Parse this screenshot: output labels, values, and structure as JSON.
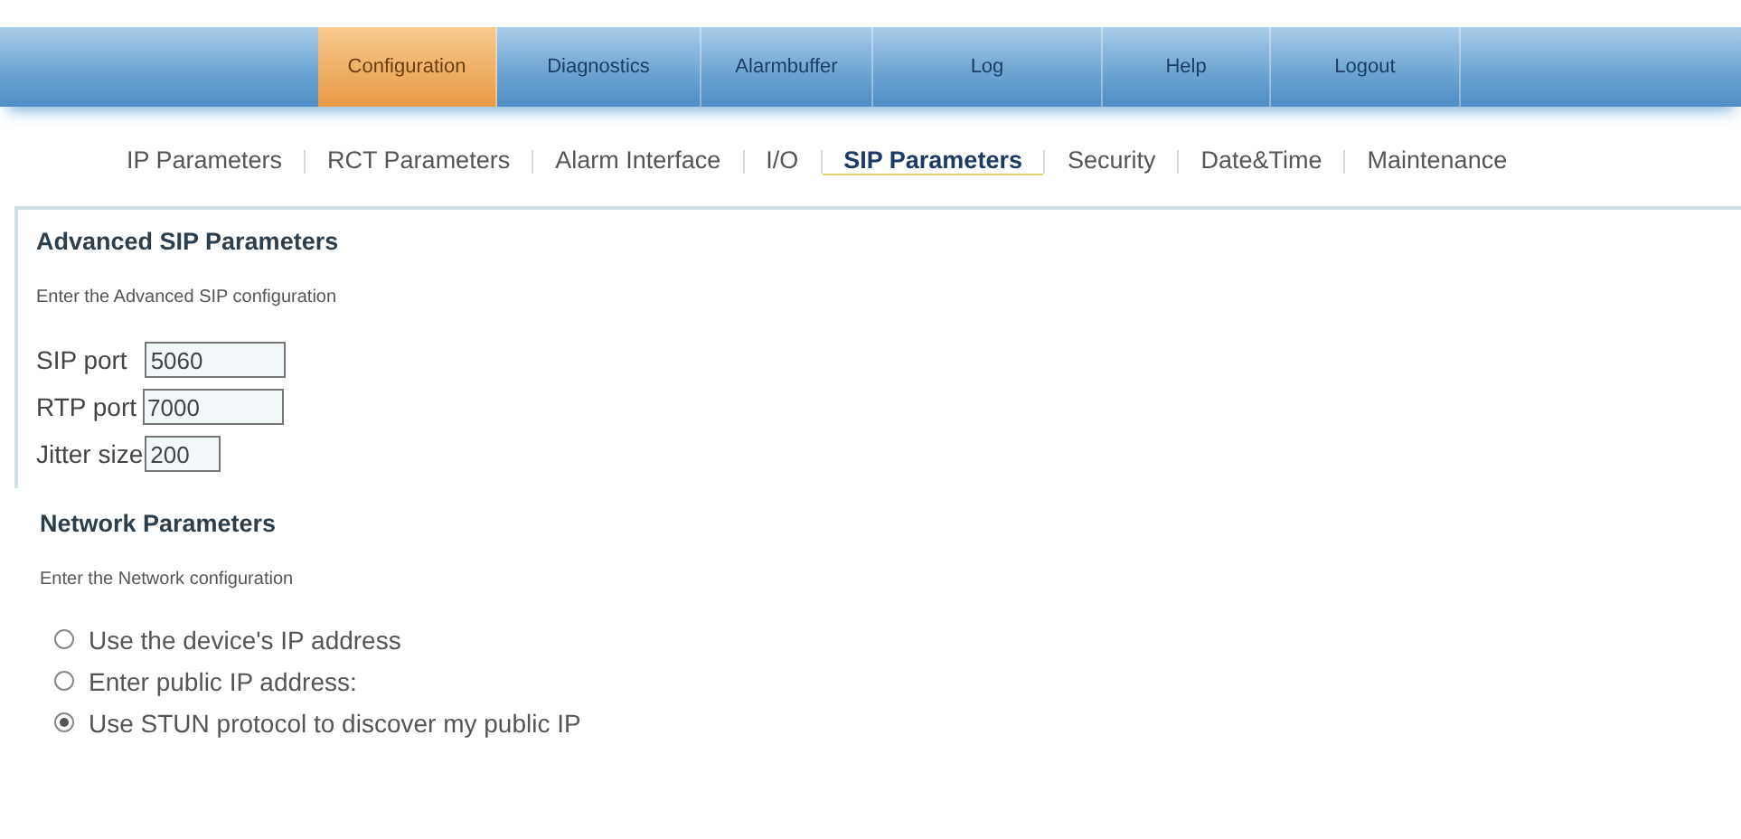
{
  "main_tabs": [
    {
      "label": "Configuration",
      "selected": true
    },
    {
      "label": "Diagnostics",
      "selected": false
    },
    {
      "label": "Alarmbuffer",
      "selected": false
    },
    {
      "label": "Log",
      "selected": false
    },
    {
      "label": "Help",
      "selected": false
    },
    {
      "label": "Logout",
      "selected": false
    }
  ],
  "sub_tabs": [
    {
      "label": "IP Parameters",
      "selected": false
    },
    {
      "label": "RCT Parameters",
      "selected": false
    },
    {
      "label": "Alarm Interface",
      "selected": false
    },
    {
      "label": "I/O",
      "selected": false
    },
    {
      "label": "SIP Parameters",
      "selected": true
    },
    {
      "label": "Security",
      "selected": false
    },
    {
      "label": "Date&Time",
      "selected": false
    },
    {
      "label": "Maintenance",
      "selected": false
    }
  ],
  "advanced": {
    "title": "Advanced SIP Parameters",
    "description": "Enter the Advanced SIP configuration",
    "fields": [
      {
        "label": "SIP port",
        "value": "5060"
      },
      {
        "label": "RTP port",
        "value": "7000"
      },
      {
        "label": "Jitter size",
        "value": "200"
      }
    ]
  },
  "network": {
    "title": "Network Parameters",
    "description": "Enter the Network configuration",
    "options": [
      {
        "label": "Use the device's IP address",
        "selected": false
      },
      {
        "label": "Enter public IP address:",
        "selected": false
      },
      {
        "label": "Use STUN protocol to discover my public IP",
        "selected": true
      }
    ]
  }
}
